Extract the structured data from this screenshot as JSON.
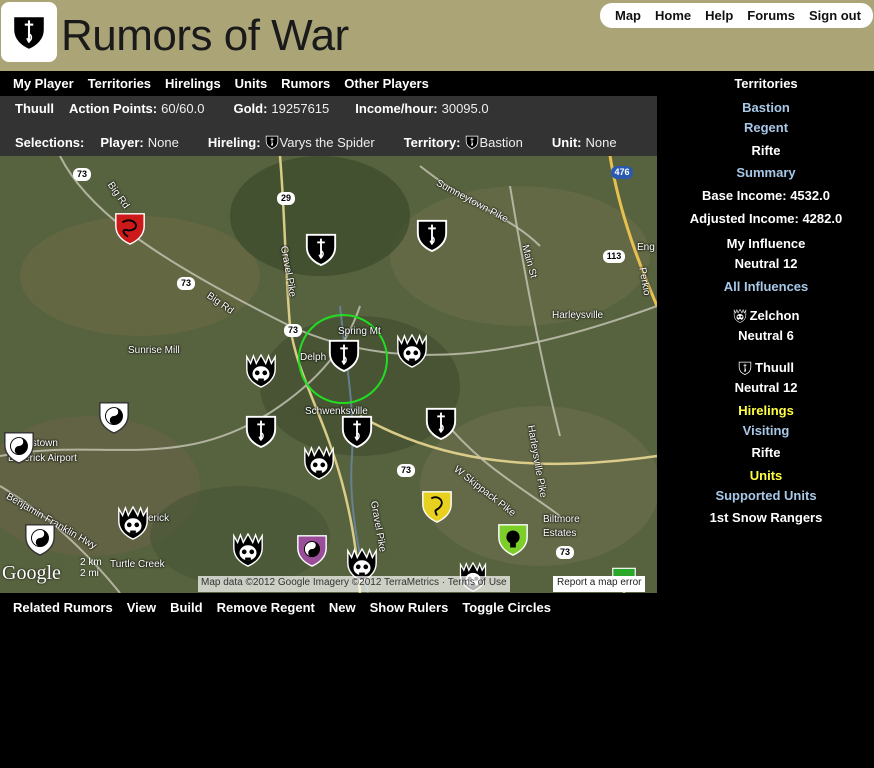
{
  "header": {
    "title": "Rumors of War",
    "nav": [
      "Map",
      "Home",
      "Help",
      "Forums",
      "Sign out"
    ]
  },
  "main_menu": [
    "My Player",
    "Territories",
    "Hirelings",
    "Units",
    "Rumors",
    "Other Players"
  ],
  "status": {
    "player": "Thuull",
    "action_points_label": "Action Points:",
    "action_points": "60/60.0",
    "gold_label": "Gold:",
    "gold": "19257615",
    "income_label": "Income/hour:",
    "income": "30095.0"
  },
  "selections": {
    "label": "Selections:",
    "player_label": "Player:",
    "player": "None",
    "hireling_label": "Hireling:",
    "hireling": "Varys the Spider",
    "territory_label": "Territory:",
    "territory": "Bastion",
    "unit_label": "Unit:",
    "unit": "None"
  },
  "map": {
    "labels": {
      "spring_mt": "Spring Mt",
      "delph": "Delph",
      "schwenksville": "Schwenksville",
      "sunrise_mill": "Sunrise Mill",
      "harleysville": "Harleysville",
      "pottstown": "Pottstown",
      "airport": "Limerick Airport",
      "biltmore": "Biltmore",
      "estates": "Estates",
      "eng": "Eng",
      "limerick": "erick",
      "turtle_creek": "Turtle Creek",
      "big_rd": "Big Rd",
      "big_rd2": "Big Rd",
      "gravel_pike": "Gravel Pike",
      "gravel_pike2": "Gravel Pike",
      "sumneytown": "Sumneytown Pike",
      "main_st": "Main St",
      "skippack": "W Skippack Pike",
      "harleysville_pike": "Harleysville Pike",
      "benjamin": "Benjamin Franklin Hwy",
      "perkio": "Perkio"
    },
    "routes": [
      "73",
      "29",
      "73",
      "73",
      "73",
      "476",
      "113",
      "73"
    ],
    "scale_km": "2 km",
    "scale_mi": "2 mi",
    "google": "Google",
    "footer": "Map data ©2012 Google Imagery ©2012 TerraMetrics · Terms of Use",
    "report": "Report a map error"
  },
  "bottom_menu": [
    "Related Rumors",
    "View",
    "Build",
    "Remove Regent",
    "New",
    "Show Rulers",
    "Toggle Circles"
  ],
  "panel": {
    "territories_heading": "Territories",
    "bastion": "Bastion",
    "regent": "Regent",
    "rifte": "Rifte",
    "summary": "Summary",
    "base_income": "Base Income: 4532.0",
    "adjusted_income": "Adjusted Income: 4282.0",
    "my_influence": "My Influence",
    "my_influence_value": "Neutral 12",
    "all_influences": "All Influences",
    "zelchon": "Zelchon",
    "zelchon_value": "Neutral 6",
    "thuull": "Thuull",
    "thuull_value": "Neutral 12",
    "hirelings": "Hirelings",
    "visiting": "Visiting",
    "rifte2": "Rifte",
    "units": "Units",
    "supported_units": "Supported Units",
    "unit_name": "1st Snow Rangers"
  },
  "colors": {
    "header_bg": "#aaa477",
    "info_bg": "#333333",
    "link_blue": "#a8c8e8",
    "highlight_yellow": "#ffff44",
    "selection_circle": "#22dd22"
  }
}
